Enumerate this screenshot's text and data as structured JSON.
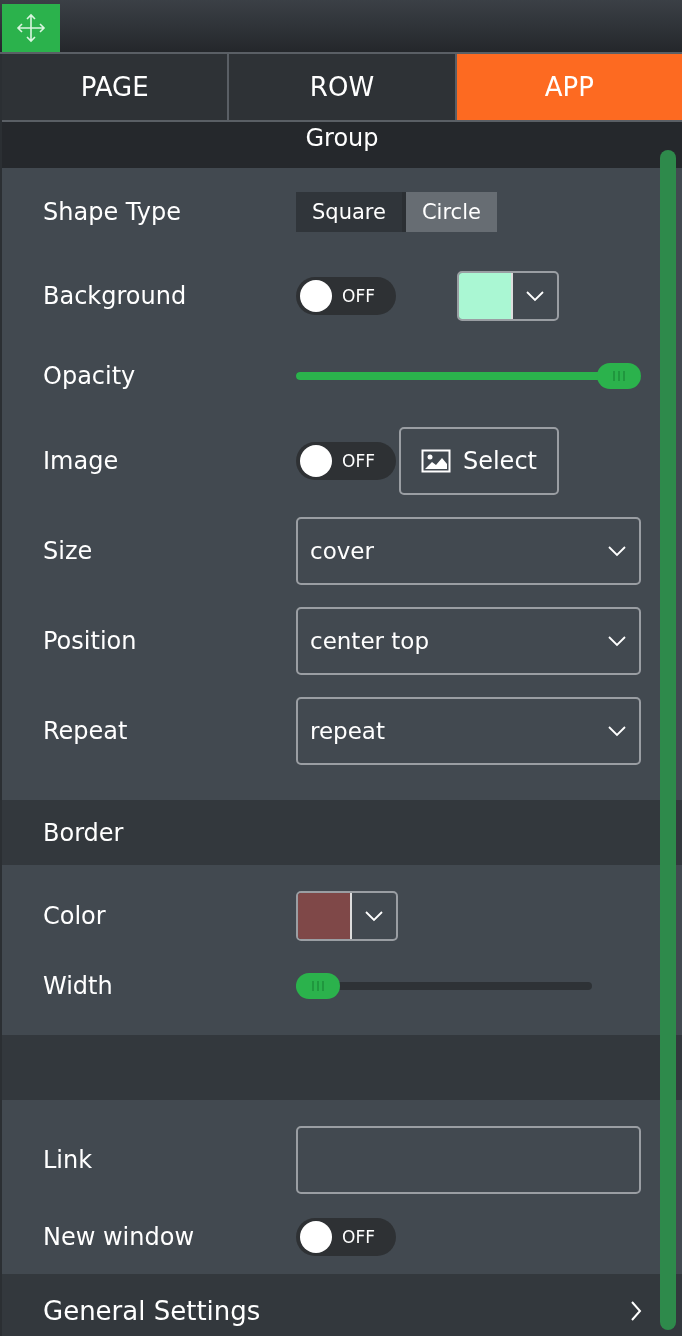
{
  "tabs": [
    {
      "label": "PAGE",
      "selected": false
    },
    {
      "label": "ROW",
      "selected": false
    },
    {
      "label": "APP",
      "selected": true
    }
  ],
  "group_title": "Group",
  "sections": [
    {
      "rows": [
        {
          "kind": "segmented",
          "label": "Shape Type",
          "options": [
            {
              "label": "Square",
              "selected": false
            },
            {
              "label": "Circle",
              "selected": true
            }
          ]
        },
        {
          "kind": "toggle_color",
          "label": "Background",
          "on": false,
          "toggle_text": "OFF",
          "color": "#aaf7d3"
        },
        {
          "kind": "slider",
          "label": "Opacity",
          "level": 1.0
        },
        {
          "kind": "toggle_button",
          "label": "Image",
          "on": false,
          "toggle_text": "OFF",
          "button": "Select"
        },
        {
          "kind": "select",
          "label": "Size",
          "value": "cover"
        },
        {
          "kind": "select",
          "label": "Position",
          "value": "center top"
        },
        {
          "kind": "select",
          "label": "Repeat",
          "value": "repeat"
        }
      ]
    },
    {
      "header": "Border",
      "rows": [
        {
          "kind": "color",
          "label": "Color",
          "color": "#7f4848"
        },
        {
          "kind": "slider",
          "label": "Width",
          "level": 0.0
        }
      ]
    },
    {
      "rows": [
        {
          "kind": "field",
          "label": "Link"
        },
        {
          "kind": "toggle",
          "label": "New window",
          "on": false,
          "toggle_text": "OFF"
        }
      ]
    }
  ],
  "footer": "General Settings"
}
